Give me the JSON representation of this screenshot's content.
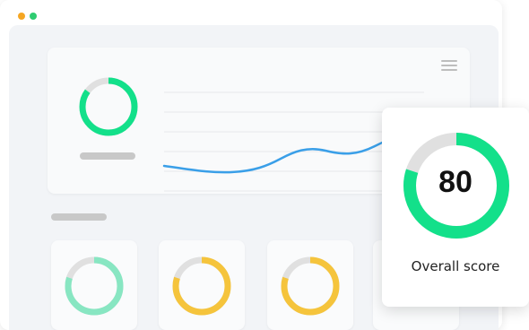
{
  "window": {
    "traffic_lights": [
      "#f5a623",
      "#2ecc71"
    ]
  },
  "dashboard": {
    "top_card": {
      "donut": {
        "progress": 0.85,
        "color": "#13e08a",
        "track": "#e0e0e0"
      },
      "menu_icon": "hamburger-menu-icon",
      "trend_line_color": "#3a9fe8"
    },
    "widgets": [
      {
        "progress": 0.8,
        "color": "#88e6c2",
        "track": "#e0e0e0"
      },
      {
        "progress": 0.8,
        "color": "#f5c43c",
        "track": "#e0e0e0"
      },
      {
        "progress": 0.8,
        "color": "#f5c43c",
        "track": "#e0e0e0"
      }
    ]
  },
  "score_card": {
    "value": "80",
    "label": "Overall score",
    "progress": 0.8,
    "color": "#13e08a",
    "track": "#e0e0e0"
  }
}
